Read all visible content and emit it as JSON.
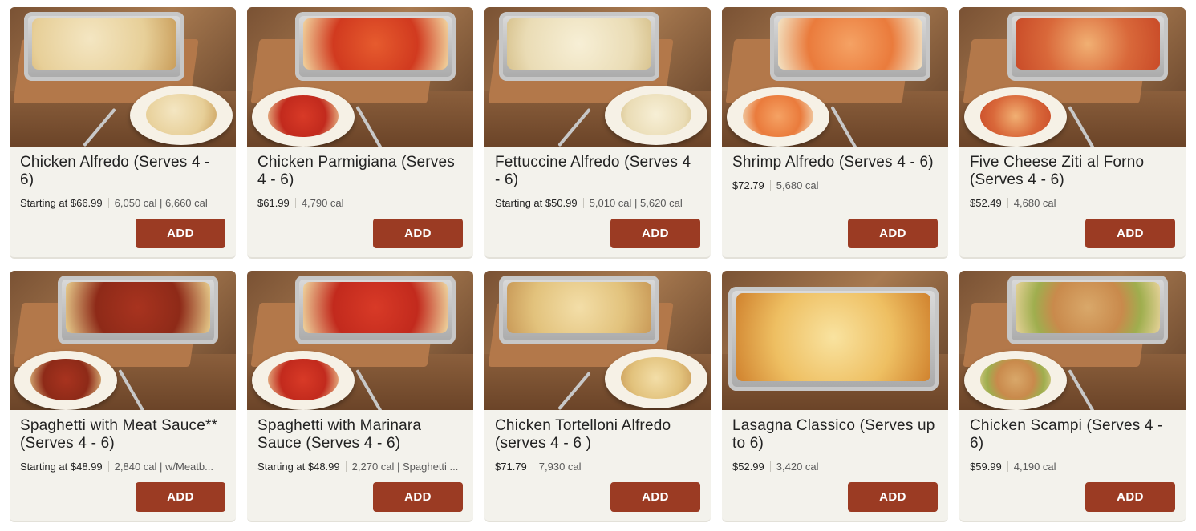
{
  "theme": {
    "button_color": "#9b3b23",
    "card_background": "#f3f2ec"
  },
  "items": [
    {
      "title": "Chicken Alfredo (Serves 4 - 6)",
      "price": "Starting at $66.99",
      "calories": "6,050 cal | 6,660 cal",
      "button": "ADD",
      "image": "chicken-alfredo-photo"
    },
    {
      "title": "Chicken Parmigiana (Serves 4 - 6)",
      "price": "$61.99",
      "calories": "4,790 cal",
      "button": "ADD",
      "image": "chicken-parmigiana-photo"
    },
    {
      "title": "Fettuccine Alfredo (Serves 4 - 6)",
      "price": "Starting at $50.99",
      "calories": "5,010 cal | 5,620 cal",
      "button": "ADD",
      "image": "fettuccine-alfredo-photo"
    },
    {
      "title": "Shrimp Alfredo (Serves 4 - 6)",
      "price": "$72.79",
      "calories": "5,680 cal",
      "button": "ADD",
      "image": "shrimp-alfredo-photo"
    },
    {
      "title": "Five Cheese Ziti al Forno (Serves 4 - 6)",
      "price": "$52.49",
      "calories": "4,680 cal",
      "button": "ADD",
      "image": "five-cheese-ziti-photo"
    },
    {
      "title": "Spaghetti with Meat Sauce** (Serves 4 - 6)",
      "price": "Starting at $48.99",
      "calories": "2,840 cal | w/Meatb...",
      "button": "ADD",
      "image": "spaghetti-meat-sauce-photo"
    },
    {
      "title": "Spaghetti with Marinara Sauce (Serves 4 - 6)",
      "price": "Starting at $48.99",
      "calories": "2,270 cal | Spaghetti ...",
      "button": "ADD",
      "image": "spaghetti-marinara-photo"
    },
    {
      "title": "Chicken Tortelloni Alfredo (serves 4 - 6 )",
      "price": "$71.79",
      "calories": "7,930 cal",
      "button": "ADD",
      "image": "chicken-tortelloni-photo"
    },
    {
      "title": "Lasagna Classico (Serves up to 6)",
      "price": "$52.99",
      "calories": "3,420 cal",
      "button": "ADD",
      "image": "lasagna-classico-photo"
    },
    {
      "title": "Chicken Scampi (Serves 4 - 6)",
      "price": "$59.99",
      "calories": "4,190 cal",
      "button": "ADD",
      "image": "chicken-scampi-photo"
    }
  ]
}
